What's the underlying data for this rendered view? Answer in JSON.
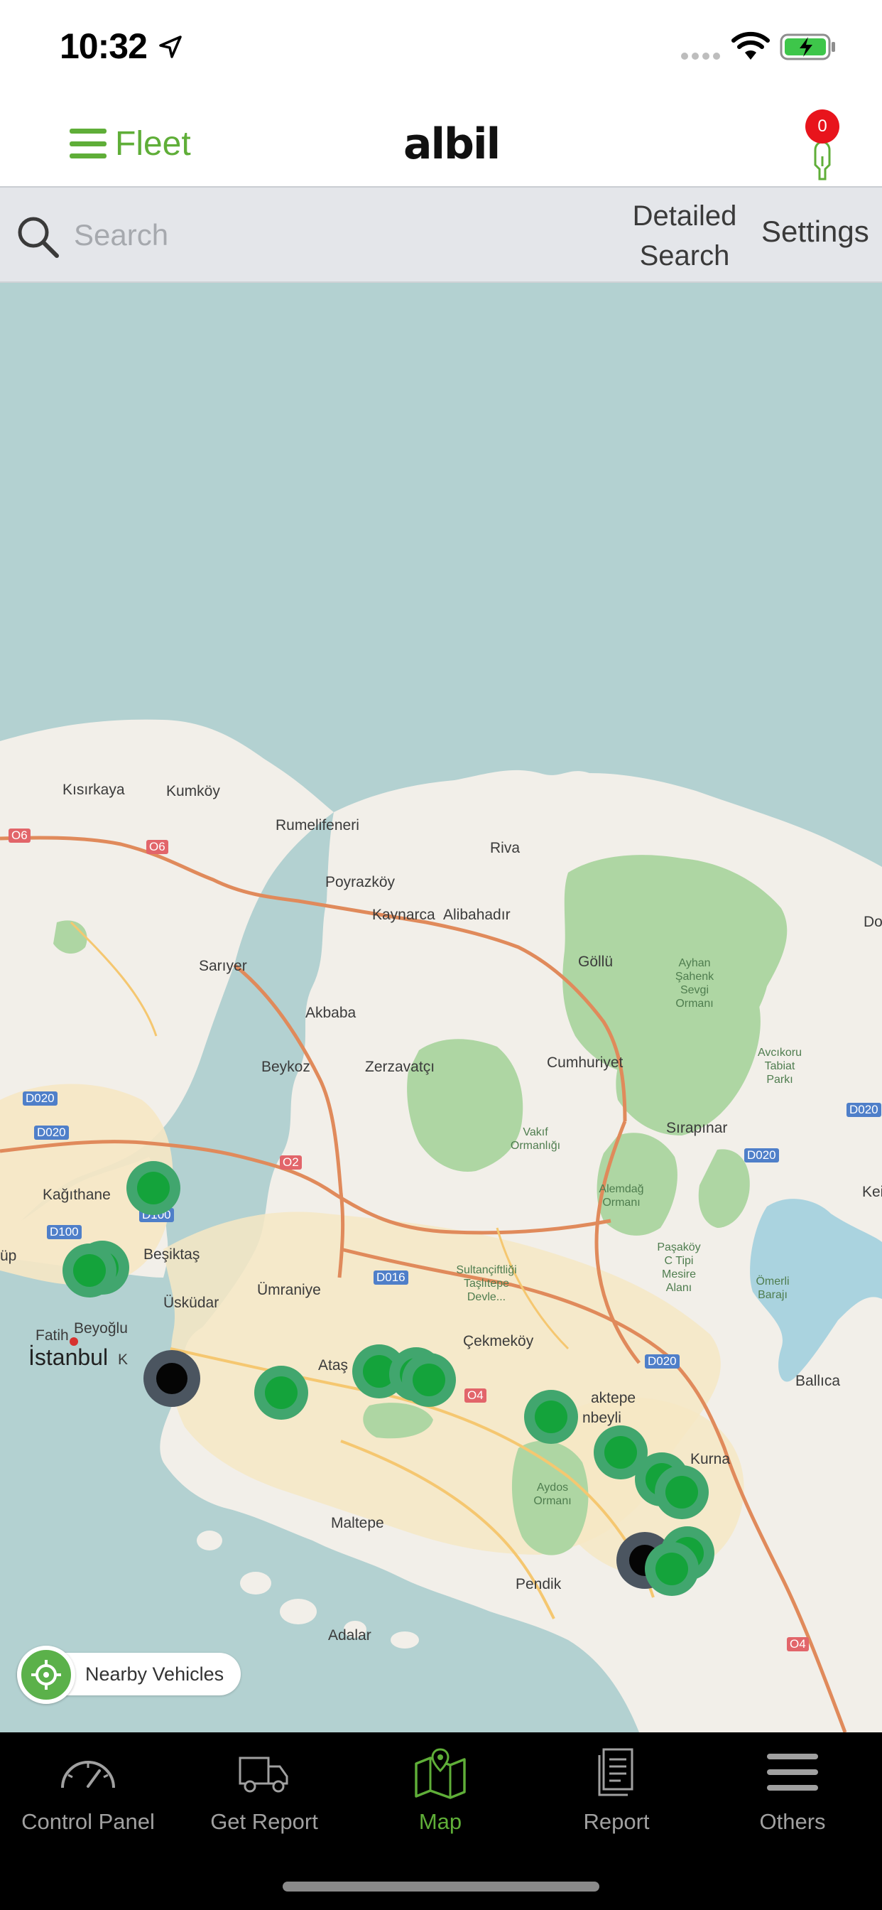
{
  "status_bar": {
    "time": "10:32"
  },
  "header": {
    "menu_label": "Fleet",
    "brand": "albil",
    "notification_count": "0"
  },
  "search": {
    "placeholder": "Search",
    "detailed_line1": "Detailed",
    "detailed_line2": "Search",
    "settings_label": "Settings"
  },
  "map": {
    "labels": [
      "Kısırkaya",
      "Kumköy",
      "Rumelifeneri",
      "Riva",
      "Poyrazköy",
      "Kaynarca",
      "Alibahadır",
      "Göllü",
      "Sarıyer",
      "Akbaba",
      "Beykoz",
      "Zerzavatçı",
      "Cumhuriyet",
      "Kağıthane",
      "Beşiktaş",
      "Ümraniye",
      "Üsküdar",
      "Fatih",
      "İstanbul",
      "Ataş",
      "Çekmeköy",
      "aktepe",
      "nbeyli",
      "Sırapınar",
      "Kurna",
      "Ballıca",
      "Maltepe",
      "Pendik",
      "Adalar",
      "Kei",
      "Do",
      "üp",
      "K"
    ],
    "parks": [
      "Ayhan Şahenk Sevgi Ormanı",
      "Avcıkoru Tabiat Parkı",
      "Vakıf Ormanlığı",
      "Alemdağ Ormanı",
      "Sultançiftliği Taşlıtepe Devle...",
      "Paşaköy C Tipi Mesire Alanı",
      "Ömerli Barajı",
      "Aydos Ormanı",
      "Beyoğlu"
    ],
    "roads": [
      "O6",
      "O6",
      "D020",
      "D020",
      "D100",
      "D100",
      "O2",
      "D016",
      "O4",
      "D020",
      "D020",
      "O4",
      "D020"
    ],
    "nearby_label": "Nearby Vehicles",
    "colors": {
      "water": "#b3d1d1",
      "land": "#f2efe9",
      "forest": "#aed6a3",
      "road": "#e08a5b",
      "marker_green": "#14a33b",
      "marker_black": "#050505"
    }
  },
  "tabs": [
    {
      "label": "Control Panel",
      "icon": "speedometer-icon",
      "active": false
    },
    {
      "label": "Get Report",
      "icon": "truck-icon",
      "active": false
    },
    {
      "label": "Map",
      "icon": "map-icon",
      "active": true
    },
    {
      "label": "Report",
      "icon": "document-icon",
      "active": false
    },
    {
      "label": "Others",
      "icon": "menu-icon",
      "active": false
    }
  ]
}
